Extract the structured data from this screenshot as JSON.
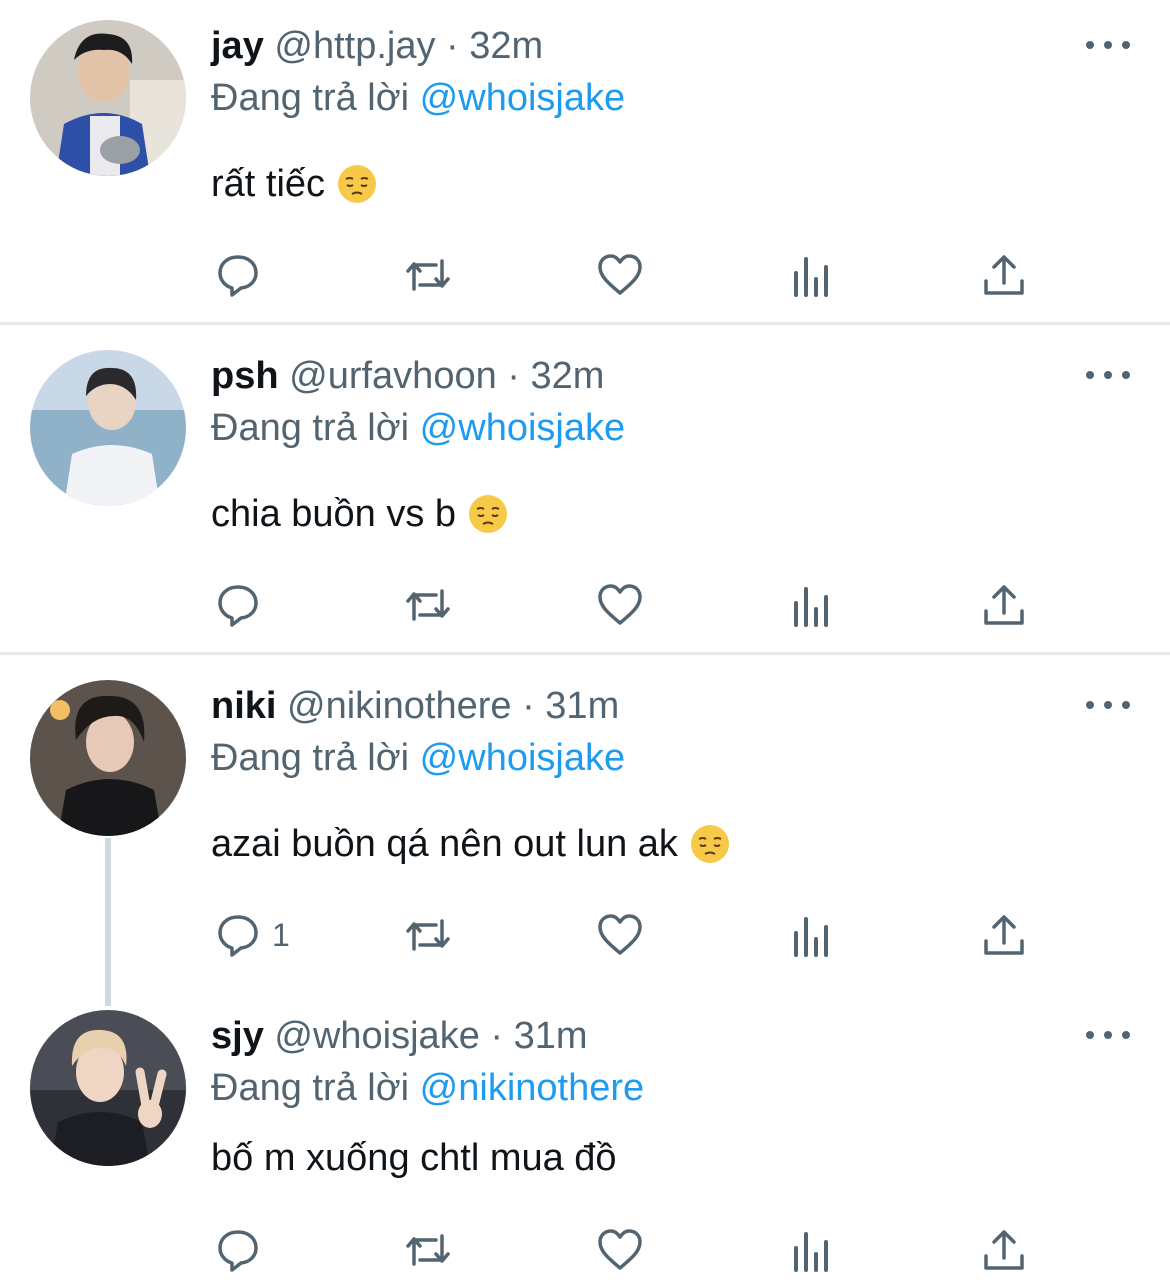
{
  "colors": {
    "text": "#0f1419",
    "muted": "#536471",
    "link": "#1d9bf0",
    "divider": "#e6e9eb"
  },
  "icons": {
    "more": "more-dots-icon",
    "reply": "reply-bubble-icon",
    "retweet": "retweet-icon",
    "like": "heart-icon",
    "views": "views-bar-chart-icon",
    "share": "share-upload-icon",
    "emoji": "pensive-face-emoji"
  },
  "tweets": [
    {
      "name": "jay",
      "handle": "@http.jay",
      "sep": "·",
      "time": "32m",
      "reply_prefix": "Đang trả lời",
      "reply_to": "@whoisjake",
      "text": "rất tiếc",
      "emoji": true,
      "reply_count": ""
    },
    {
      "name": "psh",
      "handle": "@urfavhoon",
      "sep": "·",
      "time": "32m",
      "reply_prefix": "Đang trả lời",
      "reply_to": "@whoisjake",
      "text": "chia buồn vs b",
      "emoji": true,
      "reply_count": ""
    },
    {
      "name": "niki",
      "handle": "@nikinothere",
      "sep": "·",
      "time": "31m",
      "reply_prefix": "Đang trả lời",
      "reply_to": "@whoisjake",
      "text": "azai buồn qá nên out lun ak",
      "emoji": true,
      "reply_count": "1"
    },
    {
      "name": "sjy",
      "handle": "@whoisjake",
      "sep": "·",
      "time": "31m",
      "reply_prefix": "Đang trả lời",
      "reply_to": "@nikinothere",
      "text": "bố m xuống chtl mua đồ",
      "emoji": false,
      "reply_count": ""
    }
  ]
}
